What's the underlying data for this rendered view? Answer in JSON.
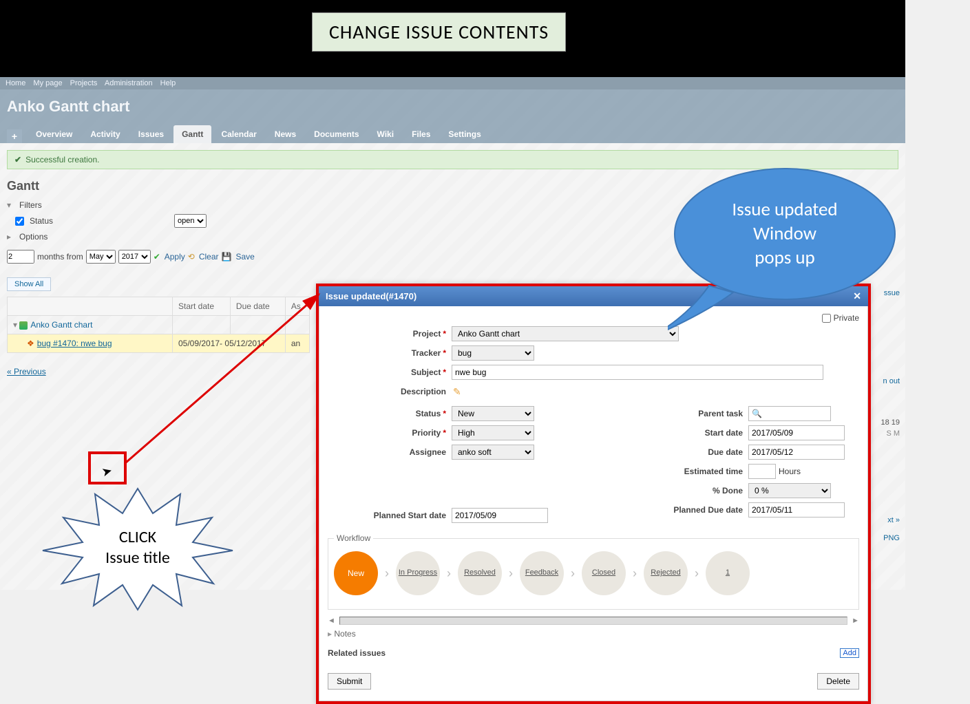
{
  "banner": "CHANGE ISSUE CONTENTS",
  "topnav": {
    "home": "Home",
    "mypage": "My page",
    "projects": "Projects",
    "admin": "Administration",
    "help": "Help"
  },
  "header": {
    "title": "Anko Gantt chart",
    "plus": "+",
    "tabs": {
      "overview": "Overview",
      "activity": "Activity",
      "issues": "Issues",
      "gantt": "Gantt",
      "calendar": "Calendar",
      "news": "News",
      "documents": "Documents",
      "wiki": "Wiki",
      "files": "Files",
      "settings": "Settings"
    }
  },
  "flash": "Successful creation.",
  "page_h2": "Gantt",
  "filters": {
    "label": "Filters",
    "status_label": "Status",
    "status_value": "open",
    "options_label": "Options"
  },
  "toolbar": {
    "months_value": "2",
    "months_label": "months from",
    "month_sel": "May",
    "year_sel": "2017",
    "apply": "Apply",
    "clear": "Clear",
    "save": "Save"
  },
  "table": {
    "show_all": "Show All",
    "cols": {
      "start": "Start date",
      "due": "Due date",
      "assignee": "As"
    },
    "project": "Anko Gantt chart",
    "issue": "bug #1470: nwe bug",
    "dates": "05/09/2017- 05/12/2017",
    "asg": "an"
  },
  "pager": {
    "prev": "« Previous"
  },
  "right_peek": {
    "issue": "ssue",
    "out": "n out",
    "date_nums": "18 19",
    "date_days": "S M",
    "next": "xt »",
    "png": "PNG"
  },
  "modal": {
    "title": "Issue updated(#1470)",
    "labels": {
      "project": "Project",
      "tracker": "Tracker",
      "subject": "Subject",
      "description": "Description",
      "status": "Status",
      "priority": "Priority",
      "assignee": "Assignee",
      "parent": "Parent task",
      "start": "Start date",
      "due": "Due date",
      "est": "Estimated time",
      "done": "% Done",
      "pstart": "Planned Start date",
      "pdue": "Planned Due date",
      "private": "Private",
      "hours": "Hours"
    },
    "values": {
      "project": "Anko Gantt chart",
      "tracker": "bug",
      "subject": "nwe bug",
      "status": "New",
      "priority": "High",
      "assignee": "anko soft",
      "start": "2017/05/09",
      "due": "2017/05/12",
      "est": "",
      "done": "0 %",
      "pstart": "2017/05/09",
      "pdue": "2017/05/11"
    },
    "workflow": {
      "legend": "Workflow",
      "steps": [
        "New",
        "In Progress",
        "Resolved",
        "Feedback",
        "Closed",
        "Rejected",
        "1"
      ]
    },
    "notes": "Notes",
    "related": "Related issues",
    "add": "Add",
    "submit": "Submit",
    "delete": "Delete"
  },
  "callouts": {
    "blue": "Issue updated Window\npops up",
    "click": "CLICK\nIssue title"
  }
}
